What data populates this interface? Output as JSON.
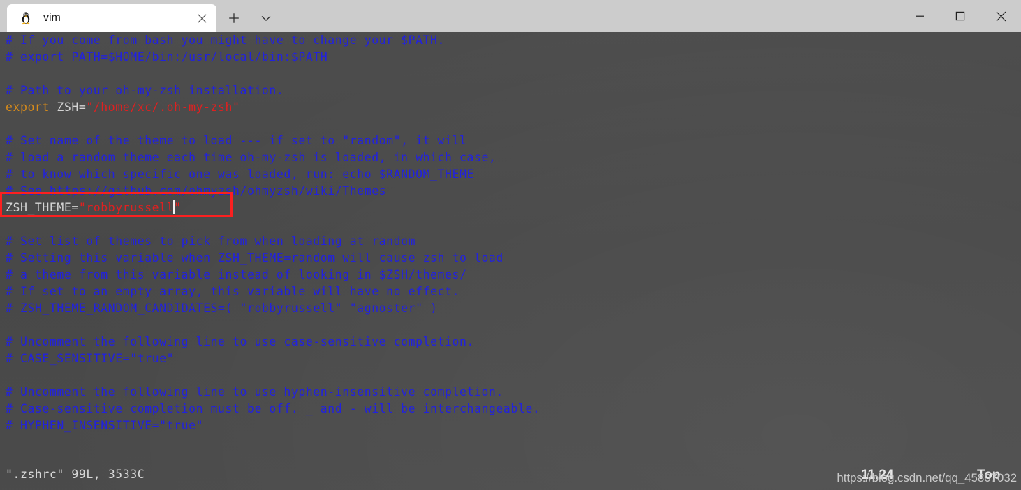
{
  "window": {
    "tab": {
      "title": "vim",
      "icon": "tux-penguin-icon",
      "close_label": "×"
    },
    "new_tab_label": "+",
    "dropdown_label": "⌄",
    "controls": {
      "minimize": "—",
      "maximize": "□",
      "close": "×"
    }
  },
  "terminal": {
    "lines": [
      {
        "y": 0,
        "segments": [
          {
            "cls": "cmt",
            "text": "# If you come from bash you might have to change your $PATH."
          }
        ]
      },
      {
        "y": 1,
        "segments": [
          {
            "cls": "cmt",
            "text": "# export PATH=$HOME/bin:/usr/local/bin:$PATH"
          }
        ]
      },
      {
        "y": 2,
        "segments": [
          {
            "cls": "plain",
            "text": ""
          }
        ]
      },
      {
        "y": 3,
        "segments": [
          {
            "cls": "cmt",
            "text": "# Path to your oh-my-zsh installation."
          }
        ]
      },
      {
        "y": 4,
        "segments": [
          {
            "cls": "kw",
            "text": "export"
          },
          {
            "cls": "id",
            "text": " ZSH="
          },
          {
            "cls": "str",
            "text": "\"/home/xc/.oh-my-zsh\""
          }
        ]
      },
      {
        "y": 5,
        "segments": [
          {
            "cls": "plain",
            "text": ""
          }
        ]
      },
      {
        "y": 6,
        "segments": [
          {
            "cls": "cmt",
            "text": "# Set name of the theme to load --- if set to \"random\", it will"
          }
        ]
      },
      {
        "y": 7,
        "segments": [
          {
            "cls": "cmt",
            "text": "# load a random theme each time oh-my-zsh is loaded, in which case,"
          }
        ]
      },
      {
        "y": 8,
        "segments": [
          {
            "cls": "cmt",
            "text": "# to know which specific one was loaded, run: echo $RANDOM_THEME"
          }
        ]
      },
      {
        "y": 9,
        "segments": [
          {
            "cls": "cmt",
            "text": "# See https://github.com/ohmyzsh/ohmyzsh/wiki/Themes"
          }
        ]
      },
      {
        "y": 10,
        "segments": [
          {
            "cls": "id",
            "text": "ZSH_THEME="
          },
          {
            "cls": "str",
            "text": "\"robbyrussell"
          },
          {
            "cls": "cursor",
            "text": ""
          },
          {
            "cls": "str",
            "text": "\""
          }
        ]
      },
      {
        "y": 11,
        "segments": [
          {
            "cls": "plain",
            "text": ""
          }
        ]
      },
      {
        "y": 12,
        "segments": [
          {
            "cls": "cmt",
            "text": "# Set list of themes to pick from when loading at random"
          }
        ]
      },
      {
        "y": 13,
        "segments": [
          {
            "cls": "cmt",
            "text": "# Setting this variable when ZSH_THEME=random will cause zsh to load"
          }
        ]
      },
      {
        "y": 14,
        "segments": [
          {
            "cls": "cmt",
            "text": "# a theme from this variable instead of looking in $ZSH/themes/"
          }
        ]
      },
      {
        "y": 15,
        "segments": [
          {
            "cls": "cmt",
            "text": "# If set to an empty array, this variable will have no effect."
          }
        ]
      },
      {
        "y": 16,
        "segments": [
          {
            "cls": "cmt",
            "text": "# ZSH_THEME_RANDOM_CANDIDATES=( \"robbyrussell\" \"agnoster\" )"
          }
        ]
      },
      {
        "y": 17,
        "segments": [
          {
            "cls": "plain",
            "text": ""
          }
        ]
      },
      {
        "y": 18,
        "segments": [
          {
            "cls": "cmt",
            "text": "# Uncomment the following line to use case-sensitive completion."
          }
        ]
      },
      {
        "y": 19,
        "segments": [
          {
            "cls": "cmt",
            "text": "# CASE_SENSITIVE=\"true\""
          }
        ]
      },
      {
        "y": 20,
        "segments": [
          {
            "cls": "plain",
            "text": ""
          }
        ]
      },
      {
        "y": 21,
        "segments": [
          {
            "cls": "cmt",
            "text": "# Uncomment the following line to use hyphen-insensitive completion."
          }
        ]
      },
      {
        "y": 22,
        "segments": [
          {
            "cls": "cmt",
            "text": "# Case-sensitive completion must be off. _ and - will be interchangeable."
          }
        ]
      },
      {
        "y": 23,
        "segments": [
          {
            "cls": "cmt",
            "text": "# HYPHEN_INSENSITIVE=\"true\""
          }
        ]
      }
    ],
    "colors": {
      "background": "#4a4a4a",
      "comment": "#2222dd",
      "keyword": "#d98c1a",
      "string": "#e02020",
      "identifier": "#d4d4d4",
      "cursor": "#f2f2f2",
      "annotation_box": "#fb2020"
    }
  },
  "status": {
    "file_info": "\".zshrc\" 99L, 3533C",
    "position": "11,24",
    "scroll": "Top"
  },
  "watermark": "https://blog.csdn.net/qq_45807032"
}
